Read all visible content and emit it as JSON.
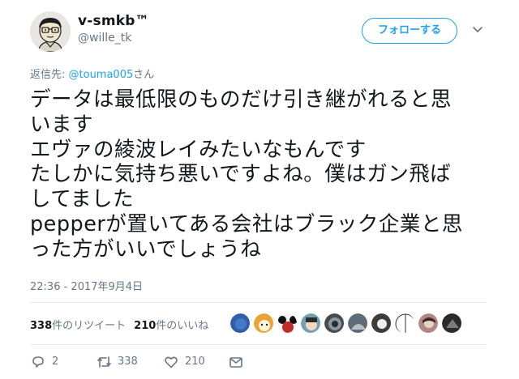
{
  "user": {
    "display_name": "v-smkb™",
    "username": "@wille_tk",
    "avatar_icon": "cartoon-glasses-avatar"
  },
  "follow_button_label": "フォローする",
  "reply_to": {
    "prefix": "返信先: ",
    "mention": "@touma005",
    "suffix": "さん"
  },
  "tweet_lines": [
    "データは最低限のものだけ引き継がれると思",
    "います",
    "エヴァの綾波レイみたいなもんです",
    "たしかに気持ち悪いですよね。僕はガン飛ば",
    "してました",
    "pepperが置いてある会社はブラック企業と思",
    "った方がいいでしょうね"
  ],
  "timestamp": "22:36 - 2017年9月4日",
  "stats": {
    "retweets_count": "338",
    "retweets_label": "件のリツイート",
    "likes_count": "210",
    "likes_label": "件のいいね"
  },
  "liker_avatars": [
    "#2f5fa8",
    "#e8a434",
    "#c22b2b",
    "#6fa1b5",
    "#4a4a4a",
    "#5f6b78",
    "#3d3d3d",
    "#ffffff",
    "#b08a80",
    "#2b2b2b"
  ],
  "actions": {
    "reply_count": "2",
    "retweet_count": "338",
    "like_count": "210"
  },
  "colors": {
    "accent": "#1da1f2",
    "muted": "#657786",
    "text": "#14171a"
  }
}
